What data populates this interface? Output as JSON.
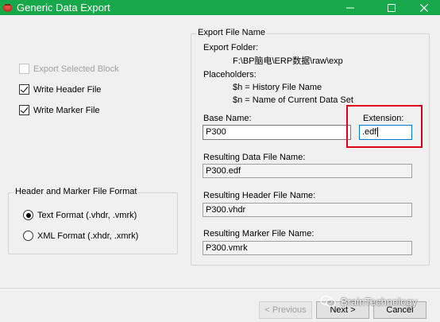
{
  "window": {
    "title": "Generic Data Export",
    "titlebar_color": "#17a84b",
    "minimize_glyph": "—",
    "maximize_glyph": "☐",
    "close_glyph": "✕"
  },
  "options": {
    "export_selected_block": {
      "label": "Export Selected Block",
      "checked": false,
      "enabled": false
    },
    "write_header_file": {
      "label": "Write Header File",
      "checked": true,
      "enabled": true
    },
    "write_marker_file": {
      "label": "Write Marker File",
      "checked": true,
      "enabled": true
    }
  },
  "format_group": {
    "legend": "Header and Marker File Format",
    "options": [
      {
        "label": "Text Format (.vhdr, .vmrk)",
        "selected": true
      },
      {
        "label": "XML Format (.xhdr, .xmrk)",
        "selected": false
      }
    ]
  },
  "export_group": {
    "legend": "Export File Name",
    "folder_label": "Export Folder:",
    "folder_path": "F:\\BP脑电\\ERP数据\\raw\\exp",
    "placeholders_label": "Placeholders:",
    "placeholder_h": "$h = History File Name",
    "placeholder_n": "$n = Name of Current Data Set",
    "base_name_label": "Base Name:",
    "base_name_value": "P300",
    "extension_label": "Extension:",
    "extension_value": ".edf",
    "data_file_label": "Resulting Data File Name:",
    "data_file_value": "P300.edf",
    "header_file_label": "Resulting Header File Name:",
    "header_file_value": "P300.vhdr",
    "marker_file_label": "Resulting Marker File Name:",
    "marker_file_value": "P300.vmrk",
    "highlight_color": "#e0001b"
  },
  "buttons": {
    "previous": "< Previous",
    "next": "Next >",
    "cancel": "Cancel"
  },
  "watermark": {
    "text": "BrainTechnology",
    "icon": "wechat-icon"
  }
}
